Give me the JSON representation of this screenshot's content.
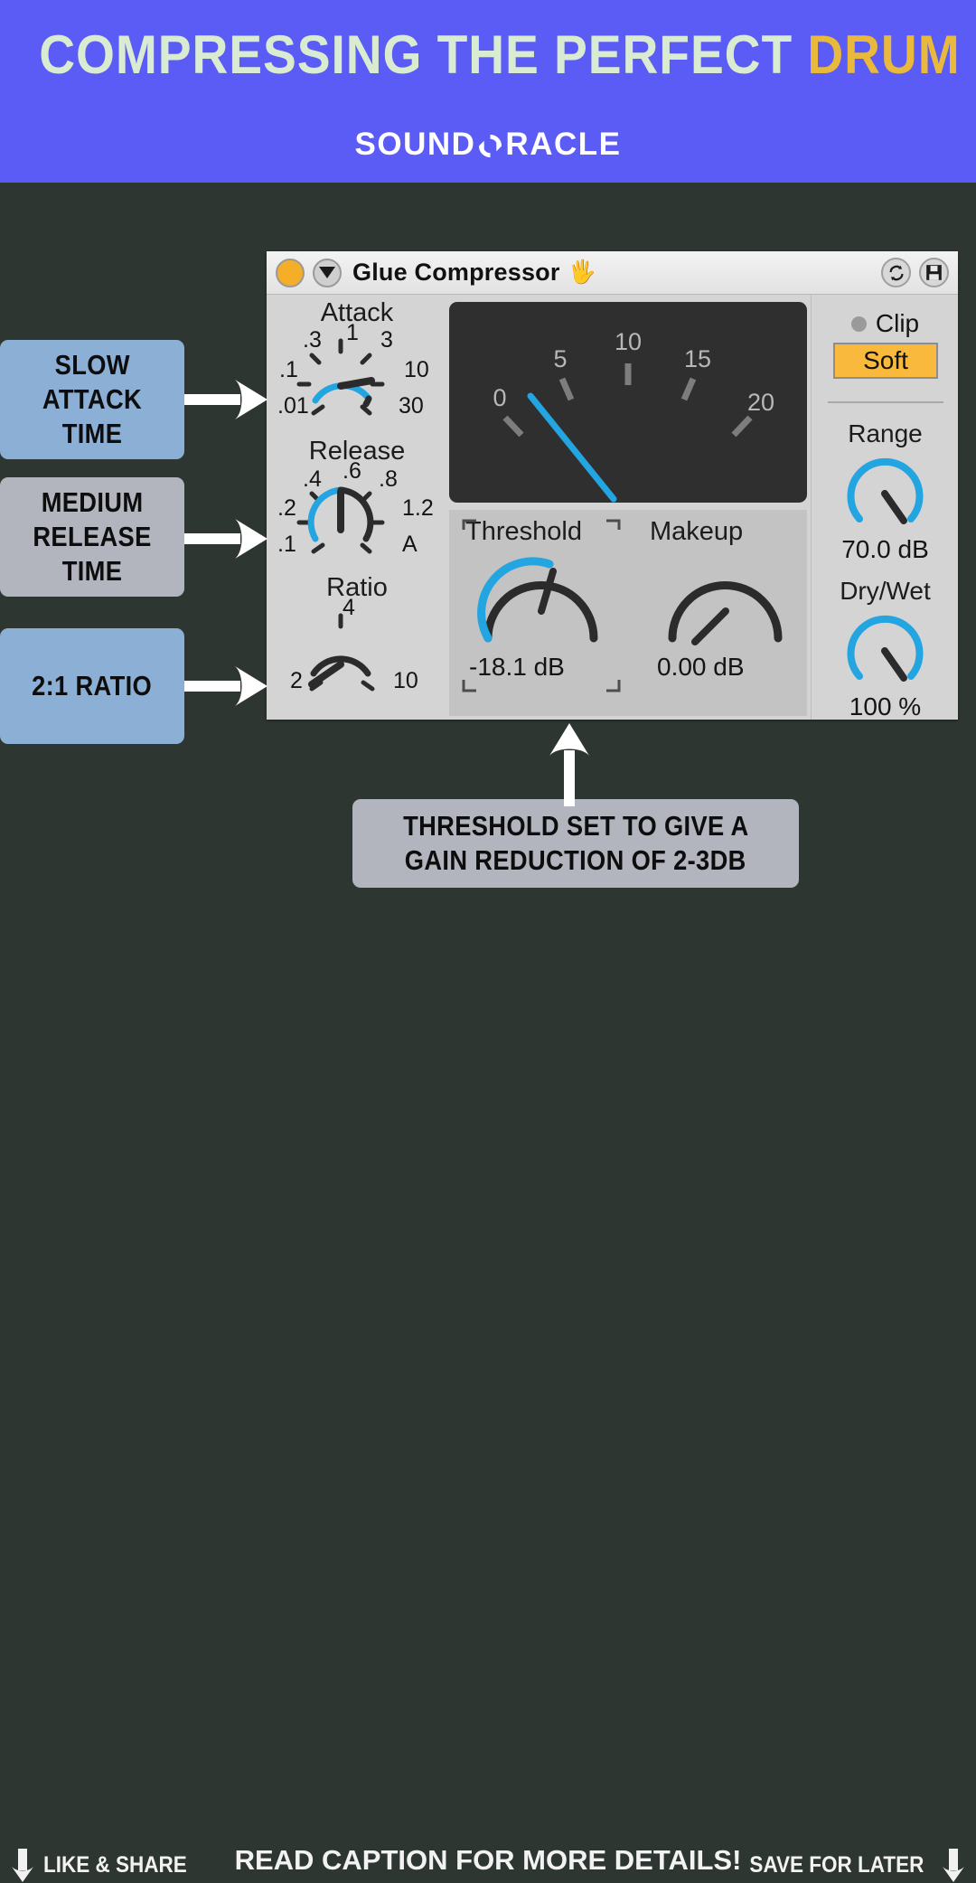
{
  "banner": {
    "title_main": "COMPRESSING THE PERFECT ",
    "title_accent": "DRUM BUS",
    "logo_part1": "SOUND",
    "logo_part2": "RACLE",
    "logo_mark": "oracle-swirl-icon",
    "bg_color": "#5b5bf5",
    "title_color": "#d9ecd2",
    "accent_color": "#e8b93c"
  },
  "plugin": {
    "title": "Glue Compressor",
    "hand_icon": "hand-icon",
    "power_icon": "power-toggle-icon",
    "collapse_icon": "triangle-down-icon",
    "hotswap_icon": "hot-swap-icon",
    "save_icon": "save-disk-icon",
    "attack": {
      "label": "Attack",
      "ticks": [
        ".01",
        ".1",
        ".3",
        "1",
        "3",
        "10",
        "30"
      ],
      "pointer_value": "10"
    },
    "release": {
      "label": "Release",
      "ticks": [
        ".1",
        ".2",
        ".4",
        ".6",
        ".8",
        "1.2",
        "A"
      ],
      "pointer_value": ".6"
    },
    "ratio": {
      "label": "Ratio",
      "ticks": [
        "2",
        "4",
        "10"
      ],
      "pointer_value": "2"
    },
    "meter": {
      "name": "gain-reduction-meter",
      "ticks": [
        "0",
        "5",
        "10",
        "15",
        "20"
      ],
      "needle_value": 2.5,
      "needle_color": "#22a5e0"
    },
    "threshold": {
      "label": "Threshold",
      "value": "-18.1 dB"
    },
    "makeup": {
      "label": "Makeup",
      "value": "0.00 dB"
    },
    "clip": {
      "label": "Clip",
      "led_on": false
    },
    "soft_button": {
      "label": "Soft",
      "active": true,
      "color": "#f9b93d"
    },
    "range": {
      "label": "Range",
      "value": "70.0 dB"
    },
    "drywet": {
      "label": "Dry/Wet",
      "value": "100 %"
    }
  },
  "callouts": [
    {
      "id": "attack",
      "lines": [
        "SLOW",
        "ATTACK TIME"
      ],
      "color": "#8cafd6"
    },
    {
      "id": "release",
      "lines": [
        "MEDIUM",
        "RELEASE TIME"
      ],
      "color": "#b2b4be"
    },
    {
      "id": "ratio",
      "lines": [
        "2:1 RATIO"
      ],
      "color": "#8cafd6"
    },
    {
      "id": "threshold",
      "lines": [
        "THRESHOLD SET TO GIVE A",
        "GAIN REDUCTION OF 2-3DB"
      ],
      "color": "#b2b4be"
    }
  ],
  "footer": {
    "left_label": "LIKE & SHARE",
    "center_label": "READ CAPTION FOR MORE DETAILS!",
    "right_label": "SAVE FOR LATER",
    "left_icon": "arrow-down-icon",
    "right_icon": "arrow-down-icon"
  }
}
